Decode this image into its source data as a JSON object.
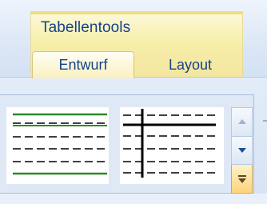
{
  "ribbon": {
    "context_group_label": "Tabellentools",
    "tabs": [
      {
        "label": "Entwurf",
        "selected": true
      },
      {
        "label": "Layout",
        "selected": false
      }
    ]
  },
  "table_styles_gallery": {
    "thumbnails": [
      {
        "icon": "table-style-green-rules-icon",
        "accent_color": "#2b8a2b",
        "selected": false
      },
      {
        "icon": "table-style-black-grid-icon",
        "accent_color": "#000000",
        "selected": false
      }
    ],
    "scroll_buttons": [
      "scroll-up",
      "scroll-down",
      "more"
    ]
  },
  "colors": {
    "tab_text": "#15428b",
    "context_highlight": "#f6eea9",
    "ribbon_background": "#d6e3f4"
  }
}
